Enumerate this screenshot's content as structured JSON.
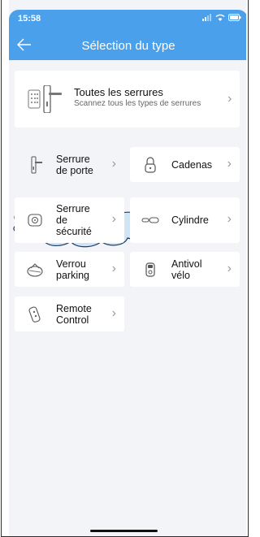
{
  "status": {
    "time": "15:58"
  },
  "header": {
    "title": "Sélection du type"
  },
  "all_locks": {
    "title": "Toutes les serrures",
    "subtitle": "Scannez tous les types de serrures"
  },
  "tiles": [
    {
      "label": "Serrure de porte",
      "line1": "Serrure",
      "line2": "de porte",
      "icon": "door-lock-icon"
    },
    {
      "label": "Cadenas",
      "line1": "Cadenas",
      "icon": "padlock-icon"
    },
    {
      "label": "Serrure de sécurité",
      "line1": "Serrure",
      "line2": "de",
      "line3": "sécurité",
      "icon": "safe-lock-icon"
    },
    {
      "label": "Cylindre",
      "line1": "Cylindre",
      "icon": "cylinder-icon"
    },
    {
      "label": "Verrou parking",
      "line1": "Verrou",
      "line2": "parking",
      "icon": "parking-lock-icon"
    },
    {
      "label": "Antivol vélo",
      "line1": "Antivol",
      "line2": "vélo",
      "icon": "bike-lock-icon"
    },
    {
      "label": "Remote Control",
      "line1": "Remote",
      "line2": "Control",
      "icon": "remote-control-icon"
    }
  ],
  "colors": {
    "header": "#4aa0ea",
    "background": "#f3f4f7",
    "highlight": "#cfe4f7"
  }
}
